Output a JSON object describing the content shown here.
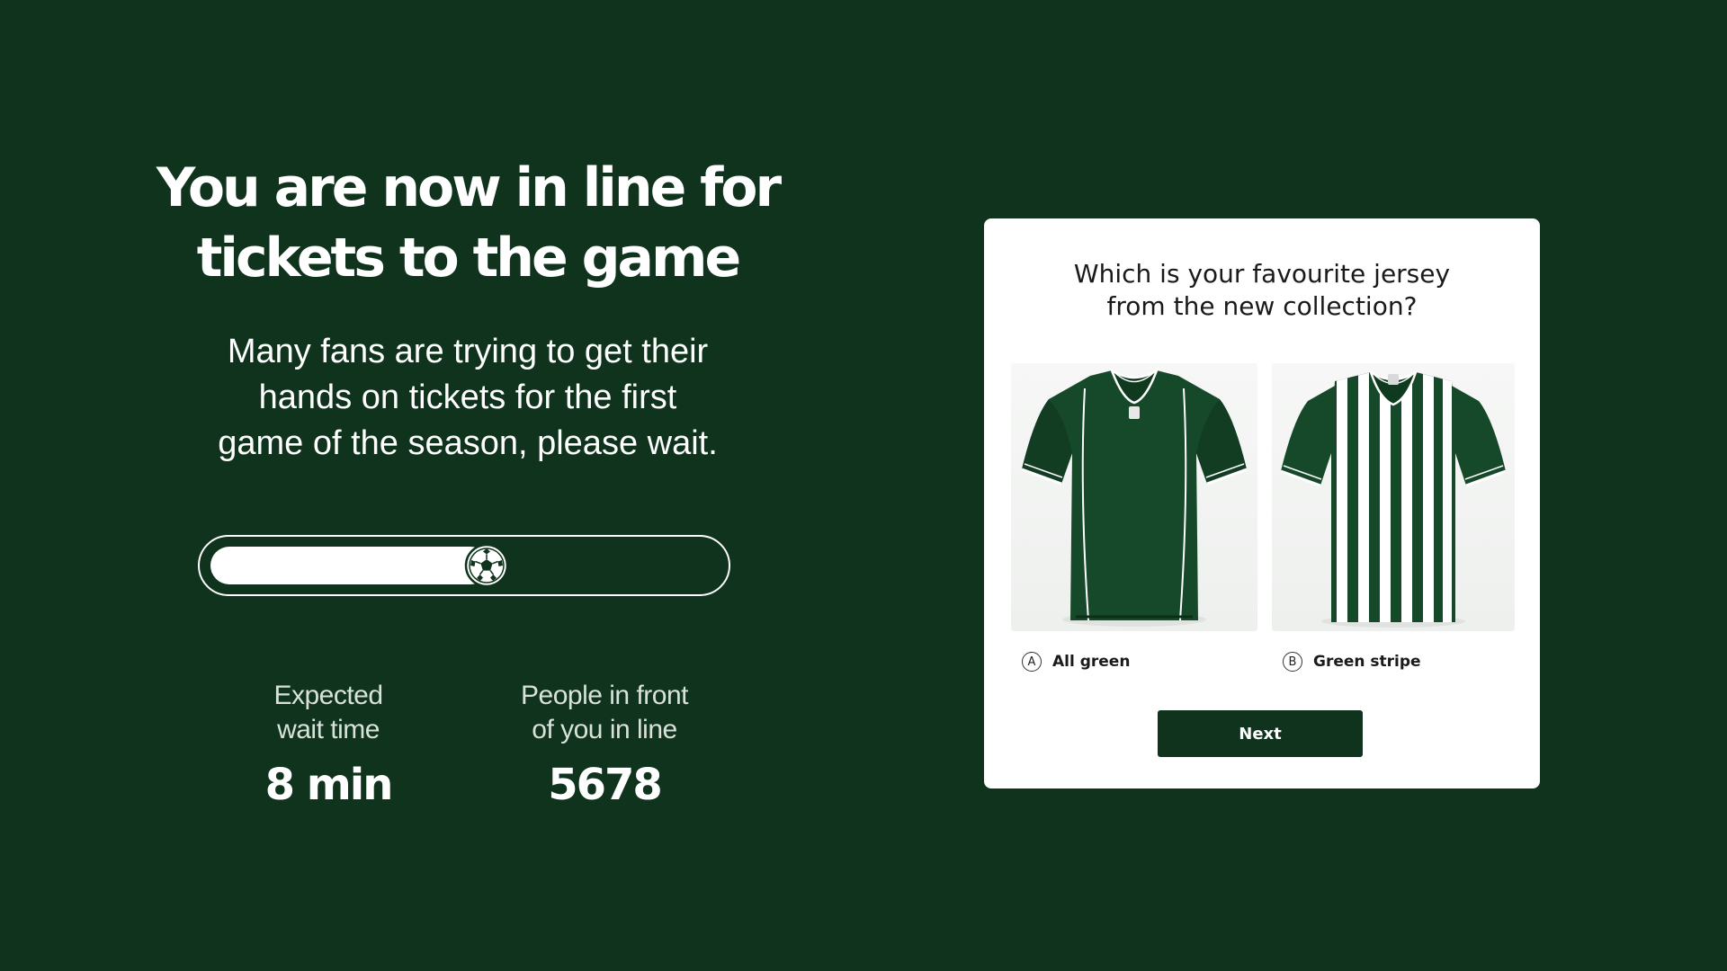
{
  "colors": {
    "background": "#0f331d",
    "text": "#ffffff",
    "card": "#ffffff",
    "button": "#0f331d"
  },
  "queue": {
    "headline": [
      "You are now in line for",
      "tickets to the game"
    ],
    "message": [
      "Many fans are trying to get their",
      "hands on tickets for the first",
      "game of the season, please wait."
    ],
    "progress": 0.55,
    "progress_icon": "soccer-ball-icon",
    "stats": {
      "wait": {
        "label": [
          "Expected",
          "wait time"
        ],
        "value": "8 min"
      },
      "people": {
        "label": [
          "People in front",
          "of you in line"
        ],
        "value": "5678"
      }
    }
  },
  "poll": {
    "question": [
      "Which is your favourite jersey",
      "from the new collection?"
    ],
    "options": [
      {
        "letter": "A",
        "label": "All green",
        "image": "all-green-jersey"
      },
      {
        "letter": "B",
        "label": "Green stripe",
        "image": "green-stripe-jersey"
      }
    ],
    "next_label": "Next"
  }
}
